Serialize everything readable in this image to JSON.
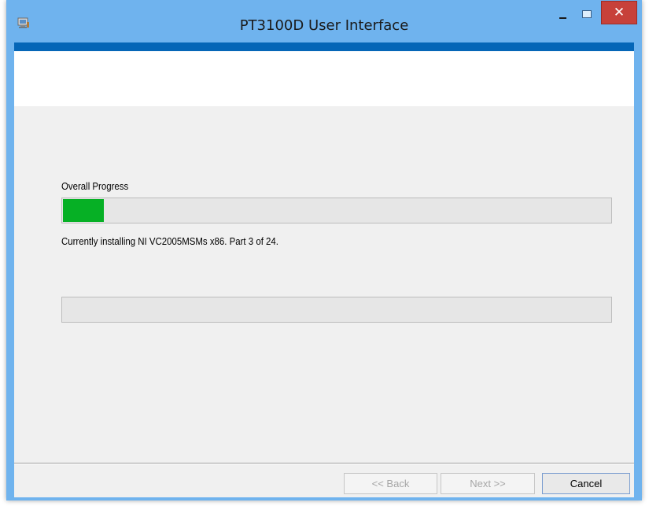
{
  "window": {
    "title": "PT3100D User Interface",
    "close_label": "✕"
  },
  "installer": {
    "overall_label": "Overall Progress",
    "overall_progress_percent": 7.5,
    "status_text": "Currently installing NI VC2005MSMs x86.  Part 3 of 24.",
    "secondary_progress_percent": 0
  },
  "footer": {
    "back_label": "<< Back",
    "next_label": "Next >>",
    "cancel_label": "Cancel",
    "back_enabled": false,
    "next_enabled": false
  },
  "colors": {
    "titlebar": "#6fb3ee",
    "header_strip": "#0566b7",
    "progress_fill": "#06b025",
    "close_button": "#c7413a"
  },
  "icons": {
    "app": "installer-app-icon",
    "minimize": "minimize-icon",
    "maximize": "maximize-icon",
    "close": "close-icon"
  }
}
